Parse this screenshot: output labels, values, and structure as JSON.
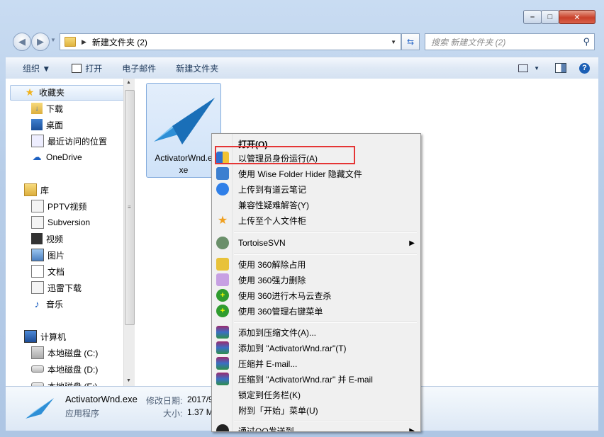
{
  "window": {
    "min_glyph": "–",
    "max_glyph": "□",
    "close_glyph": "✕"
  },
  "address": {
    "path": "新建文件夹 (2)",
    "search_placeholder": "搜索 新建文件夹 (2)"
  },
  "toolbar": {
    "organize": "组织 ▼",
    "open": "打开",
    "email": "电子邮件",
    "new_folder": "新建文件夹"
  },
  "nav": {
    "favorites": "收藏夹",
    "downloads": "下载",
    "desktop": "桌面",
    "recent": "最近访问的位置",
    "onedrive": "OneDrive",
    "libraries": "库",
    "pptv": "PPTV视频",
    "subversion": "Subversion",
    "videos": "视频",
    "pictures": "图片",
    "documents": "文档",
    "thunder": "迅雷下载",
    "music": "音乐",
    "computer": "计算机",
    "disk_c": "本地磁盘 (C:)",
    "disk_d": "本地磁盘 (D:)",
    "disk_e": "本地磁盘 (E:)"
  },
  "file": {
    "name_line1": "ActivatorWnd.e",
    "name_line2": "xe"
  },
  "details": {
    "filename": "ActivatorWnd.exe",
    "modified_label": "修改日期:",
    "modified_value": "2017/9",
    "type": "应用程序",
    "size_label": "大小:",
    "size_value": "1.37 M"
  },
  "menu": {
    "open": "打开(O)",
    "run_as_admin": "以管理员身份运行(A)",
    "wise_hide": "使用 Wise Folder Hider 隐藏文件",
    "youdao": "上传到有道云笔记",
    "compat": "兼容性疑难解答(Y)",
    "personal_cabinet": "上传至个人文件柜",
    "tortoise": "TortoiseSVN",
    "unlock360": "使用 360解除占用",
    "delete360": "使用 360强力删除",
    "scan360": "使用 360进行木马云查杀",
    "manage360": "使用 360管理右键菜单",
    "add_archive": "添加到压缩文件(A)...",
    "add_rar": "添加到 \"ActivatorWnd.rar\"(T)",
    "compress_email": "压缩并 E-mail...",
    "compress_rar_email": "压缩到 \"ActivatorWnd.rar\" 并 E-mail",
    "pin_taskbar": "锁定到任务栏(K)",
    "pin_start": "附到「开始」菜单(U)",
    "send_qq": "通过QQ发送到"
  }
}
